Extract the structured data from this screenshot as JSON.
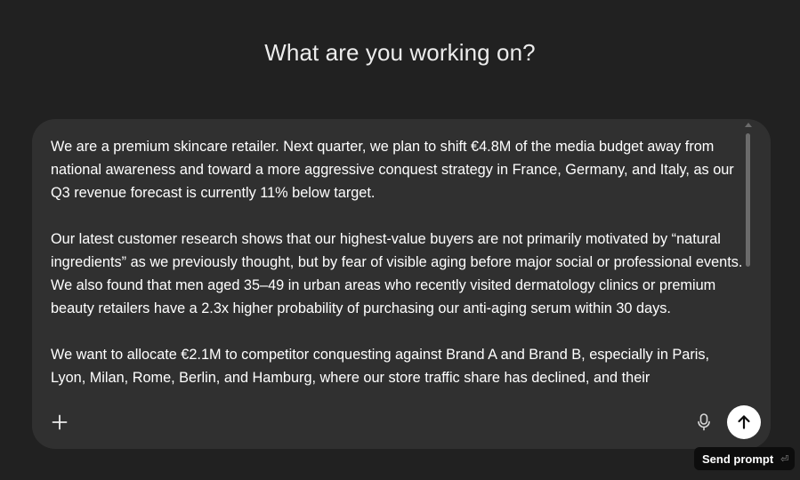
{
  "heading": "What are you working on?",
  "composer": {
    "paragraphs": [
      "We are a premium skincare retailer. Next quarter, we plan to shift €4.8M of the media budget away from national awareness and toward a more aggressive conquest strategy in France, Germany, and Italy, as our Q3 revenue forecast is currently 11% below target.",
      "Our latest customer research shows that our highest-value buyers are not primarily motivated by “natural ingredients” as we previously thought, but by fear of visible aging before major social or professional events. We also found that men aged 35–49 in urban areas who recently visited dermatology clinics or premium beauty retailers have a 2.3x higher probability of purchasing our anti-aging serum within 30 days.",
      "We want to allocate €2.1M to competitor conquesting against Brand A and Brand B, especially in Paris, Lyon, Milan, Rome, Berlin, and Hamburg, where our store traffic share has declined, and their"
    ],
    "add_icon": "plus-icon",
    "mic_icon": "microphone-icon",
    "send_icon": "arrow-up-icon"
  },
  "tooltip": {
    "label": "Send prompt",
    "shortcut_icon": "enter-key-icon",
    "shortcut_glyph": "⏎"
  }
}
